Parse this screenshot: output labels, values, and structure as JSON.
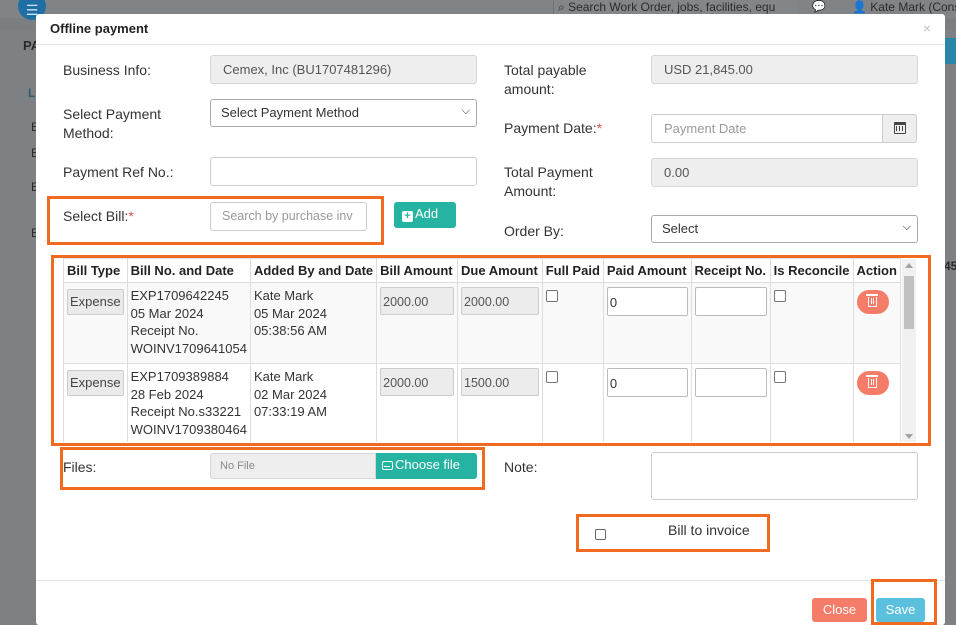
{
  "background": {
    "search_placeholder": "Search Work Order, jobs, facilities, equ",
    "user_name": "Kate Mark (Cons",
    "page_heading_fragment": "PA",
    "section_fragment": "L",
    "row_fragments": [
      "E",
      "E",
      "E",
      "E"
    ],
    "amount_fragment": "45"
  },
  "modal": {
    "title": "Offline payment",
    "close_label": "×"
  },
  "form": {
    "business_info_label": "Business Info:",
    "business_info_value": "Cemex, Inc (BU1707481296)",
    "total_payable_label": "Total payable amount:",
    "total_payable_value": "USD 21,845.00",
    "payment_method_label": "Select Payment Method:",
    "payment_method_value": "Select Payment Method",
    "payment_date_label": "Payment Date:",
    "payment_date_required": "*",
    "payment_date_placeholder": "Payment Date",
    "payment_ref_label": "Payment Ref No.:",
    "payment_ref_value": "",
    "total_payment_label": "Total Payment Amount:",
    "total_payment_value": "0.00",
    "select_bill_label": "Select Bill:",
    "select_bill_required": "*",
    "select_bill_placeholder": "Search by purchase inv",
    "add_label": "Add",
    "order_by_label": "Order By:",
    "order_by_value": "Select"
  },
  "table": {
    "headers": [
      "Bill Type",
      "Bill No. and Date",
      "Added By and Date",
      "Bill Amount",
      "Due Amount",
      "Full Paid",
      "Paid Amount",
      "Receipt No.",
      "Is Reconcile",
      "Action"
    ],
    "rows": [
      {
        "bill_type": "Expense",
        "bill_no": "EXP1709642245",
        "bill_date": "05 Mar 2024",
        "receipt": "Receipt No.",
        "invoice": "WOINV1709641054",
        "added_by": "Kate Mark",
        "added_date": "05 Mar 2024",
        "added_time": "05:38:56 AM",
        "bill_amount": "2000.00",
        "due_amount": "2000.00",
        "full_paid": false,
        "paid_amount": "0",
        "receipt_no": "",
        "is_reconcile": false
      },
      {
        "bill_type": "Expense",
        "bill_no": "EXP1709389884",
        "bill_date": "28 Feb 2024",
        "receipt": "Receipt No.s33221",
        "invoice": "WOINV1709380464",
        "added_by": "Kate Mark",
        "added_date": "02 Mar 2024",
        "added_time": "07:33:19 AM",
        "bill_amount": "2000.00",
        "due_amount": "1500.00",
        "full_paid": false,
        "paid_amount": "0",
        "receipt_no": "",
        "is_reconcile": false
      }
    ]
  },
  "files": {
    "label": "Files:",
    "file_name": "No File",
    "choose_label": "Choose file"
  },
  "note": {
    "label": "Note:",
    "value": ""
  },
  "bill_to_invoice": {
    "label": "Bill to invoice",
    "checked": false
  },
  "footer": {
    "close_label": "Close",
    "save_label": "Save"
  },
  "colors": {
    "accent_teal": "#26b3a2",
    "danger": "#f47c68",
    "info": "#5bc0de",
    "highlight": "#f06a1f"
  }
}
